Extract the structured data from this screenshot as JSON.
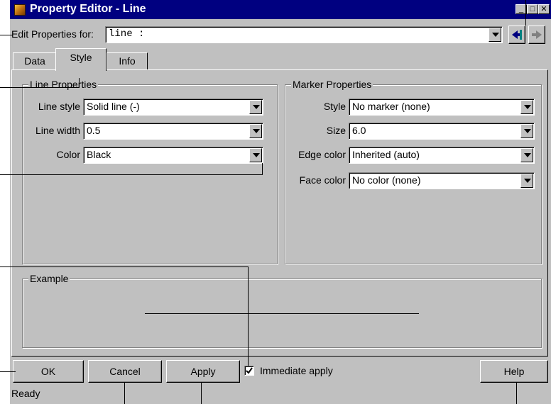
{
  "window": {
    "title": "Property Editor - Line",
    "controls": {
      "minimize": "_",
      "maximize": "□",
      "close": "✕"
    }
  },
  "header": {
    "edit_label": "Edit Properties for:",
    "object_value": "line :",
    "nav_icons": [
      "back-arrow-icon",
      "forward-arrow-icon"
    ]
  },
  "tabs": [
    {
      "label": "Data",
      "selected": false
    },
    {
      "label": "Style",
      "selected": true
    },
    {
      "label": "Info",
      "selected": false
    }
  ],
  "line_properties": {
    "title": "Line Properties",
    "rows": [
      {
        "label": "Line style",
        "value": "Solid line (-)"
      },
      {
        "label": "Line width",
        "value": "0.5"
      },
      {
        "label": "Color",
        "value": "Black"
      }
    ]
  },
  "marker_properties": {
    "title": "Marker Properties",
    "rows": [
      {
        "label": "Style",
        "value": "No marker (none)"
      },
      {
        "label": "Size",
        "value": "6.0"
      },
      {
        "label": "Edge color",
        "value": "Inherited (auto)"
      },
      {
        "label": "Face color",
        "value": "No color (none)"
      }
    ]
  },
  "example": {
    "title": "Example"
  },
  "buttons": {
    "ok": "OK",
    "cancel": "Cancel",
    "apply": "Apply",
    "help": "Help"
  },
  "immediate_apply": {
    "label": "Immediate apply",
    "checked": true
  },
  "status": {
    "text": "Ready"
  },
  "colors": {
    "titlebar": "#000080",
    "face": "#c0c0c0",
    "shadow": "#808080"
  }
}
